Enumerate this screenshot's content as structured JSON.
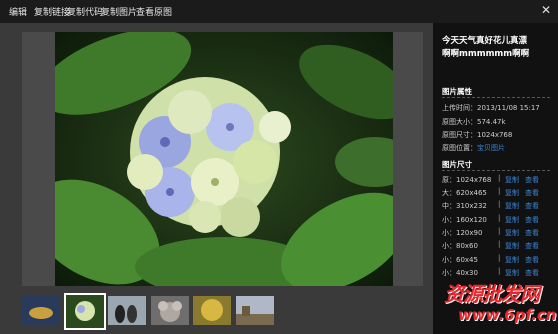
{
  "toolbar": {
    "items": [
      "编辑",
      "复制链接",
      "复制代码",
      "复制图片",
      "查看原图"
    ],
    "close_glyph": "✕"
  },
  "info": {
    "title_line1": "今天天气真好花儿真漂",
    "title_line2": "啊啊mmmmmm啊啊",
    "props_heading": "图片属性",
    "upload_label": "上传时间：",
    "upload_value": "2013/11/08 15:17",
    "size_label": "原图大小：",
    "size_value": "574.47k",
    "dim_label": "原图尺寸：",
    "dim_value": "1024x768",
    "pos_label": "原图位置：",
    "pos_value": "宝贝图片",
    "sizes_heading": "图片尺寸",
    "sizes": [
      {
        "label": "原：1024x768",
        "copy": "复制",
        "view": "查看"
      },
      {
        "label": "大：620x465",
        "copy": "复制",
        "view": "查看"
      },
      {
        "label": "中：310x232",
        "copy": "复制",
        "view": "查看"
      },
      {
        "label": "小：160x120",
        "copy": "复制",
        "view": "查看"
      },
      {
        "label": "小：120x90",
        "copy": "复制",
        "view": "查看"
      },
      {
        "label": "小：80x60",
        "copy": "复制",
        "view": "查看"
      },
      {
        "label": "小：60x45",
        "copy": "复制",
        "view": "查看"
      },
      {
        "label": "小：40x30",
        "copy": "复制",
        "view": "查看"
      }
    ]
  },
  "watermark": {
    "line1": "资源批发网",
    "line2": "www.6pf.cn"
  },
  "colors": {
    "toolbar_bg": "#1b1b1b",
    "panel_bg": "#111111",
    "link": "#3b86d4",
    "watermark": "#e8262b"
  }
}
